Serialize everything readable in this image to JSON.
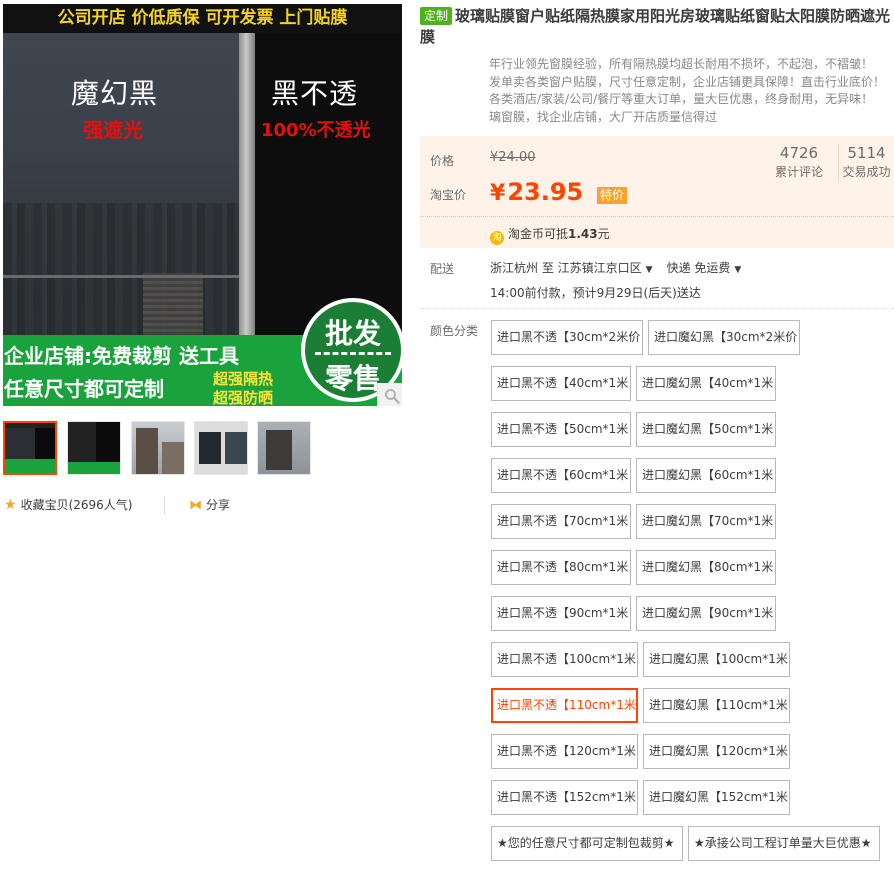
{
  "gallery": {
    "banner_top": "公司开店 价低质保 可开发票 上门贴膜",
    "left_title": "魔幻黑",
    "left_sub": "强遮光",
    "right_title": "黑不透",
    "right_sub": "100%不透光",
    "bottom_line1": "企业店铺:免费裁剪 送工具",
    "bottom_line2": "任意尺寸都可定制",
    "bottom_line3": "超强隔热",
    "bottom_line4": "超强防晒",
    "badge_top": "批发",
    "badge_bottom": "零售",
    "zoom_icon": "magnifier-icon",
    "thumbnails_count": 5,
    "active_thumbnail": 1
  },
  "actions": {
    "favorite_label": "收藏宝贝",
    "favorite_count": "(2696人气)",
    "share_label": "分享"
  },
  "product": {
    "tag": "定制",
    "title": "玻璃贴膜窗户贴纸隔热膜家用阳光房玻璃贴纸窗贴太阳膜防晒遮光膜",
    "subtitle_lines": [
      "一年行业领先窗膜经验，所有隔热膜均超长耐用不损坏，不起泡，不褶皱！",
      "批发单卖各类窗户贴膜，尺寸任意定制，企业店铺更具保障！直击行业底价！",
      "接各类酒店/家装/公司/餐厅等重大订单，量大巨优惠，终身耐用，无异味！",
      "玻璃窗膜，找企业店铺，大厂开店质量信得过"
    ]
  },
  "price": {
    "original_label": "价格",
    "original_value": "¥24.00",
    "taobao_label": "淘宝价",
    "currency": "¥",
    "taobao_value": "23.95",
    "special_tag": "特价",
    "review_count": "4726",
    "review_label": "累计评论",
    "sales_count": "5114",
    "sales_label": "交易成功",
    "coin_text_prefix": "淘金币可抵",
    "coin_amount": "1.43",
    "coin_unit": "元",
    "accent_color": "#ff4400"
  },
  "delivery": {
    "label": "配送",
    "from": "浙江杭州 至",
    "to": "江苏镇江京口区",
    "method": "快递 免运费",
    "eta": "14:00前付款，预计9月29日(后天)送达"
  },
  "color_section": {
    "label": "颜色分类",
    "options": [
      "进口黑不透【30cm*2米价",
      "进口魔幻黑【30cm*2米价",
      "进口黑不透【40cm*1米",
      "进口魔幻黑【40cm*1米",
      "进口黑不透【50cm*1米",
      "进口魔幻黑【50cm*1米",
      "进口黑不透【60cm*1米",
      "进口魔幻黑【60cm*1米",
      "进口黑不透【70cm*1米",
      "进口魔幻黑【70cm*1米",
      "进口黑不透【80cm*1米",
      "进口魔幻黑【80cm*1米",
      "进口黑不透【90cm*1米",
      "进口魔幻黑【90cm*1米",
      "进口黑不透【100cm*1米",
      "进口魔幻黑【100cm*1米",
      "进口黑不透【110cm*1米",
      "进口魔幻黑【110cm*1米",
      "进口黑不透【120cm*1米",
      "进口魔幻黑【120cm*1米",
      "进口黑不透【152cm*1米",
      "进口魔幻黑【152cm*1米",
      "★您的任意尺寸都可定制包裁剪★",
      "★承接公司工程订单量大巨优惠★"
    ],
    "selected_option": "进口黑不透【110cm*1米"
  }
}
